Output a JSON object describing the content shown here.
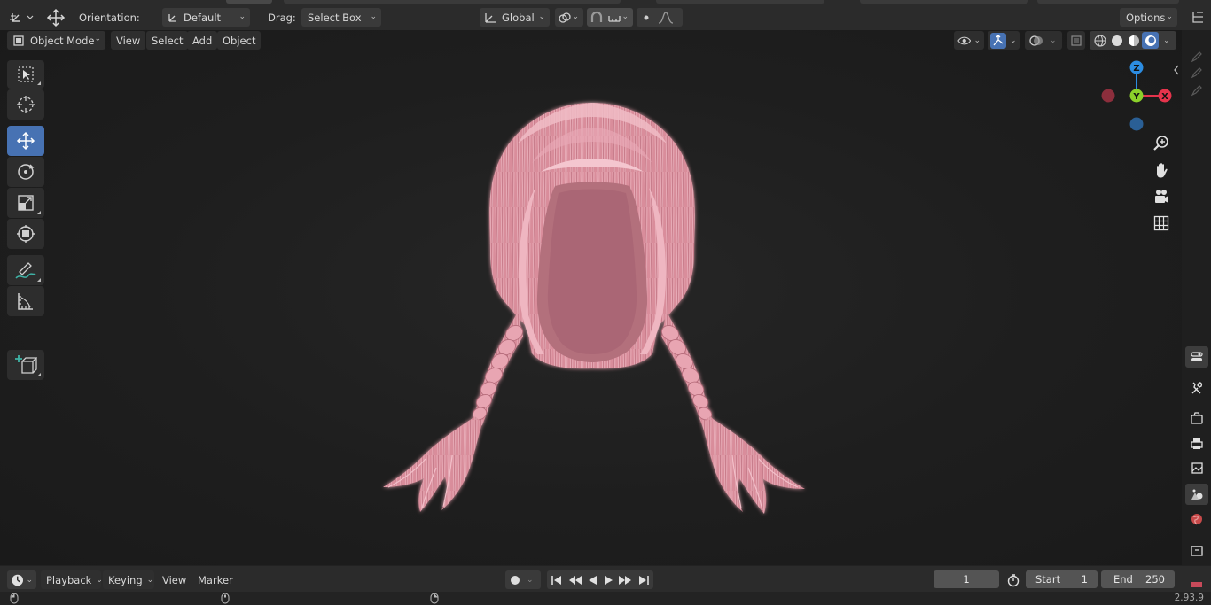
{
  "header": {
    "orientation_label": "Orientation:",
    "orientation_value": "Default",
    "drag_label": "Drag:",
    "drag_value": "Select Box",
    "transform_orientation": "Global",
    "options_label": "Options"
  },
  "viewport_header": {
    "mode": "Object Mode",
    "menus": [
      "View",
      "Select",
      "Add",
      "Object"
    ]
  },
  "toolbar": {
    "tools": [
      "select-box",
      "cursor",
      "move",
      "rotate",
      "scale",
      "transform",
      "annotate",
      "measure",
      "add-cube"
    ],
    "active_tool": "move"
  },
  "gizmo": {
    "axes": [
      "Z",
      "Y",
      "X"
    ],
    "colors": {
      "x": "#e5344c",
      "y": "#8bd12a",
      "z": "#2c8de2"
    }
  },
  "timeline": {
    "menus": [
      "Playback",
      "Keying",
      "View",
      "Marker"
    ],
    "current_frame": "1",
    "start_label": "Start",
    "start_value": "1",
    "end_label": "End",
    "end_value": "250"
  },
  "status": {
    "version": "2.93.9"
  },
  "theme": {
    "accent": "#4772b3",
    "hair": "#d98d9b"
  }
}
